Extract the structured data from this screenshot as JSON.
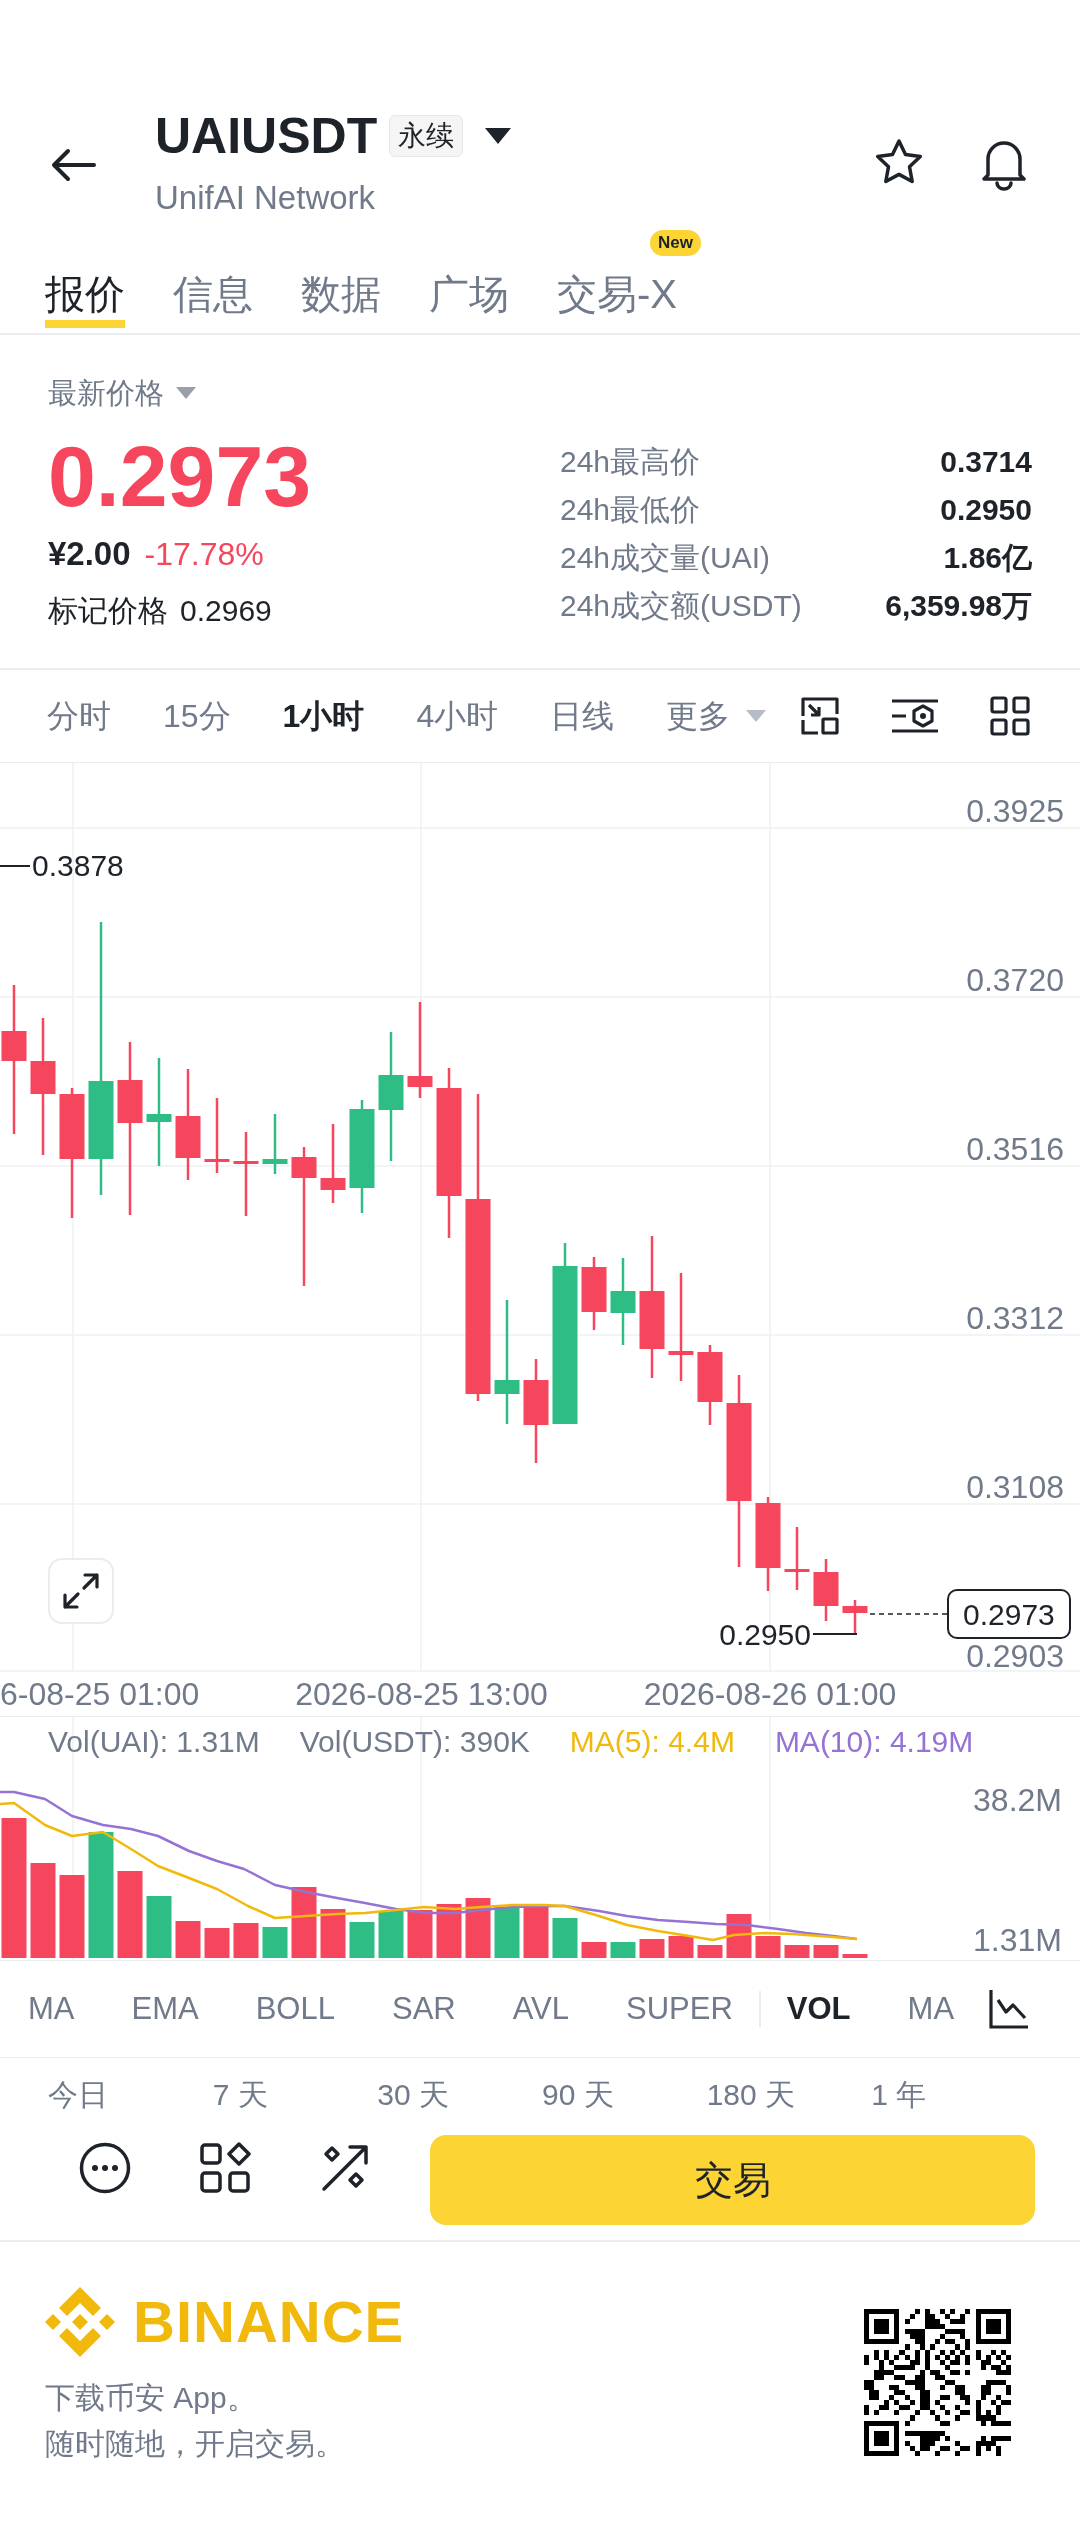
{
  "header": {
    "symbol": "UAIUSDT",
    "contract_tag": "永续",
    "asset_name": "UnifAI Network"
  },
  "tabs": [
    {
      "label": "报价",
      "selected": true
    },
    {
      "label": "信息",
      "selected": false
    },
    {
      "label": "数据",
      "selected": false
    },
    {
      "label": "广场",
      "selected": false
    },
    {
      "label": "交易-X",
      "selected": false,
      "badge": "New"
    }
  ],
  "price": {
    "label": "最新价格",
    "last": "0.2973",
    "fiat": "¥2.00",
    "change": "-17.78%",
    "mark_label": "标记价格",
    "mark_value": "0.2969"
  },
  "stats": [
    {
      "label": "24h最高价",
      "value": "0.3714"
    },
    {
      "label": "24h最低价",
      "value": "0.2950"
    },
    {
      "label": "24h成交量(UAI)",
      "value": "1.86亿"
    },
    {
      "label": "24h成交额(USDT)",
      "value": "6,359.98万"
    }
  ],
  "intervals": [
    {
      "label": "分时",
      "kind": "interval",
      "selected": false
    },
    {
      "label": "15分",
      "kind": "interval",
      "selected": false
    },
    {
      "label": "1小时",
      "kind": "interval",
      "selected": true
    },
    {
      "label": "4小时",
      "kind": "interval",
      "selected": false
    },
    {
      "label": "日线",
      "kind": "interval",
      "selected": false
    },
    {
      "label": "更多",
      "kind": "menu",
      "selected": false
    }
  ],
  "price_chart": {
    "price_labels": [
      "0.3925",
      "0.3720",
      "0.3516",
      "0.3312",
      "0.3108",
      "0.2903"
    ],
    "high_label": "0.3878",
    "low_label": "0.2950",
    "last_price_tag": "0.2973",
    "time_labels": [
      "6-08-25 01:00",
      "2026-08-25 13:00",
      "2026-08-26 01:00"
    ]
  },
  "volume": {
    "legend": [
      {
        "text": "Vol(UAI): 1.31M",
        "color": "#707a8a"
      },
      {
        "text": "Vol(USDT): 390K",
        "color": "#707a8a"
      },
      {
        "text": "MA(5): 4.4M",
        "color": "#f0b90b"
      },
      {
        "text": "MA(10): 4.19M",
        "color": "#9672d4"
      }
    ],
    "axis_labels": [
      "38.2M",
      "1.31M"
    ]
  },
  "indicators": {
    "main": [
      {
        "label": "MA",
        "selected": false
      },
      {
        "label": "EMA",
        "selected": false
      },
      {
        "label": "BOLL",
        "selected": false
      },
      {
        "label": "SAR",
        "selected": false
      },
      {
        "label": "AVL",
        "selected": false
      },
      {
        "label": "SUPER",
        "selected": false
      }
    ],
    "sub": [
      {
        "label": "VOL",
        "selected": true
      },
      {
        "label": "MA",
        "selected": false
      }
    ]
  },
  "ranges": [
    "今日",
    "7 天",
    "30 天",
    "90 天",
    "180 天",
    "1 年"
  ],
  "trade_button": "交易",
  "footer": {
    "brand": "BINANCE",
    "lines": [
      "下载币安 App。",
      "随时随地，开启交易。"
    ]
  }
}
